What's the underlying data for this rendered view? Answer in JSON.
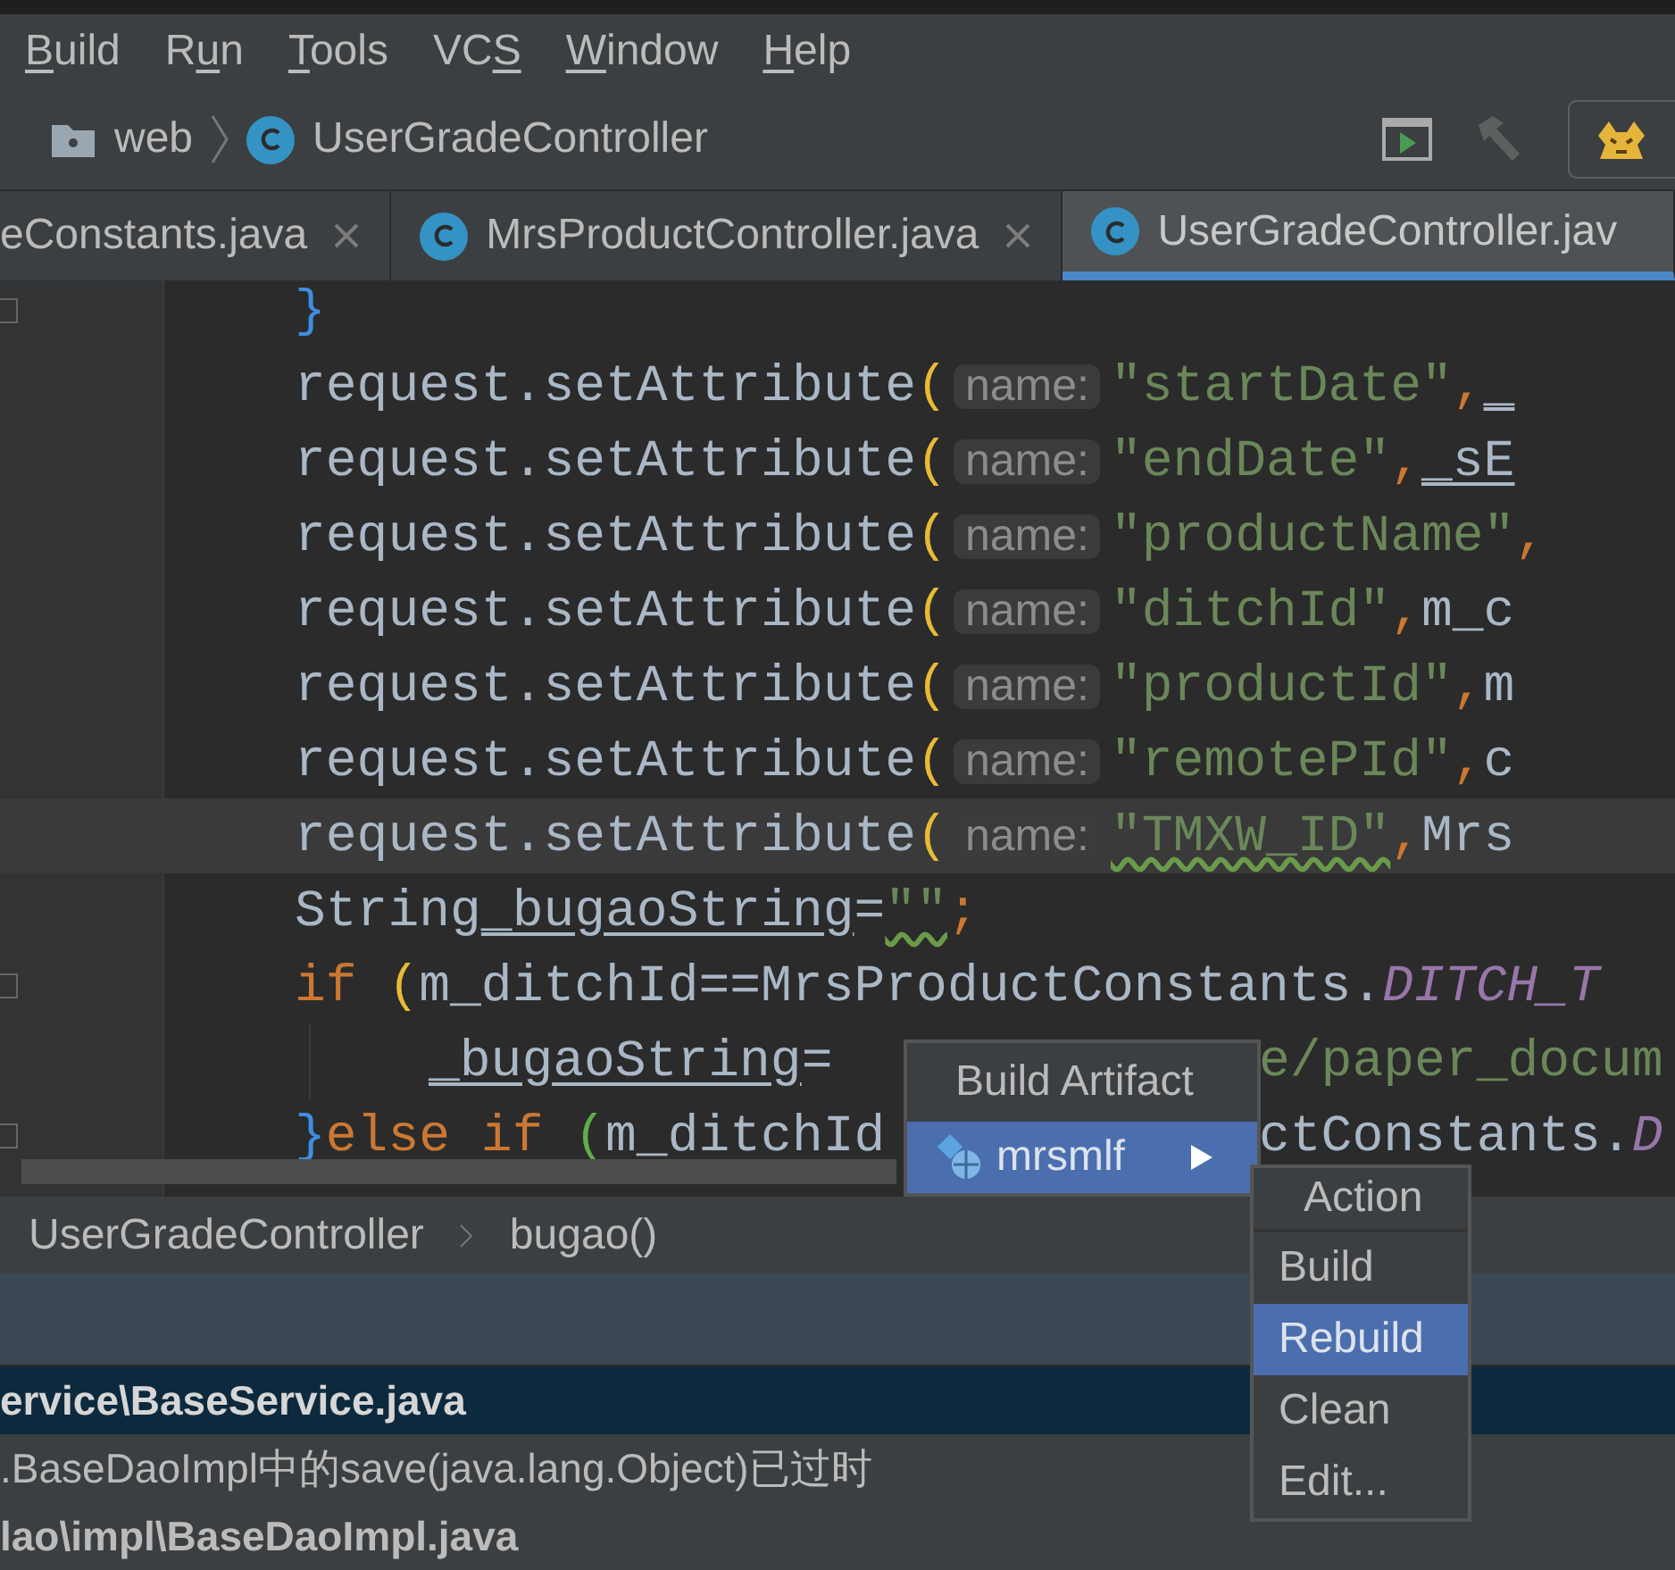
{
  "menu_bar": [
    {
      "key": "B",
      "post": "uild"
    },
    {
      "pre": "R",
      "key": "u",
      "post": "n"
    },
    {
      "key": "T",
      "post": "ools"
    },
    {
      "pre": "VC",
      "key": "S"
    },
    {
      "key": "W",
      "post": "indow"
    },
    {
      "key": "H",
      "post": "elp"
    }
  ],
  "nav_bar": {
    "folder": "web",
    "class_name": "UserGradeController",
    "build_disabled": true
  },
  "tabs": [
    {
      "label": "eConstants.java",
      "icon": false,
      "selected": false,
      "closable": true
    },
    {
      "label": "MrsProductController.java",
      "icon": true,
      "selected": false,
      "closable": true
    },
    {
      "label": "UserGradeController.jav",
      "icon": true,
      "selected": true,
      "closable": false
    }
  ],
  "code_lines": [
    {
      "fold": true,
      "current": false,
      "tokens": [
        {
          "kind": "bracket",
          "text": "}",
          "color": "#3e8ee0"
        }
      ]
    },
    {
      "fold": false,
      "current": false,
      "tokens": [
        {
          "kind": "code",
          "text": "request.setAttribute"
        },
        {
          "kind": "bracket",
          "text": "(",
          "color": "#e8ba36"
        },
        {
          "kind": "hint",
          "text": "name:"
        },
        {
          "kind": "string",
          "text": "\"startDate\""
        },
        {
          "kind": "punct",
          "text": ", "
        },
        {
          "kind": "field",
          "text": "_"
        }
      ]
    },
    {
      "fold": false,
      "current": false,
      "tokens": [
        {
          "kind": "code",
          "text": "request.setAttribute"
        },
        {
          "kind": "bracket",
          "text": "(",
          "color": "#e8ba36"
        },
        {
          "kind": "hint",
          "text": "name:"
        },
        {
          "kind": "string",
          "text": "\"endDate\""
        },
        {
          "kind": "punct",
          "text": ", "
        },
        {
          "kind": "field",
          "text": "_sE"
        }
      ]
    },
    {
      "fold": false,
      "current": false,
      "tokens": [
        {
          "kind": "code",
          "text": "request.setAttribute"
        },
        {
          "kind": "bracket",
          "text": "(",
          "color": "#e8ba36"
        },
        {
          "kind": "hint",
          "text": "name:"
        },
        {
          "kind": "string",
          "text": "\"productName\""
        },
        {
          "kind": "punct",
          "text": ","
        }
      ]
    },
    {
      "fold": false,
      "current": false,
      "tokens": [
        {
          "kind": "code",
          "text": "request.setAttribute"
        },
        {
          "kind": "bracket",
          "text": "(",
          "color": "#e8ba36"
        },
        {
          "kind": "hint",
          "text": "name:"
        },
        {
          "kind": "string",
          "text": "\"ditchId\""
        },
        {
          "kind": "punct",
          "text": ", "
        },
        {
          "kind": "code",
          "text": "m_c"
        }
      ]
    },
    {
      "fold": false,
      "current": false,
      "tokens": [
        {
          "kind": "code",
          "text": "request.setAttribute"
        },
        {
          "kind": "bracket",
          "text": "(",
          "color": "#e8ba36"
        },
        {
          "kind": "hint",
          "text": "name:"
        },
        {
          "kind": "string",
          "text": "\"productId\""
        },
        {
          "kind": "punct",
          "text": ", "
        },
        {
          "kind": "code",
          "text": "m"
        }
      ]
    },
    {
      "fold": false,
      "current": false,
      "tokens": [
        {
          "kind": "code",
          "text": "request.setAttribute"
        },
        {
          "kind": "bracket",
          "text": "(",
          "color": "#e8ba36"
        },
        {
          "kind": "hint",
          "text": "name:"
        },
        {
          "kind": "string",
          "text": "\"remotePId\""
        },
        {
          "kind": "punct",
          "text": ", "
        },
        {
          "kind": "code",
          "text": "c"
        }
      ]
    },
    {
      "fold": false,
      "current": true,
      "tokens": [
        {
          "kind": "code",
          "text": "request.setAttribute"
        },
        {
          "kind": "bracket",
          "text": "(",
          "color": "#e8ba36"
        },
        {
          "kind": "hint",
          "text": "name:"
        },
        {
          "kind": "typo",
          "text": "\"TMXW_ID\""
        },
        {
          "kind": "punct",
          "text": ", "
        },
        {
          "kind": "code",
          "text": "Mrs"
        }
      ]
    },
    {
      "fold": false,
      "current": false,
      "tokens": [
        {
          "kind": "code",
          "text": "String "
        },
        {
          "kind": "field",
          "text": "_bugaoString"
        },
        {
          "kind": "code",
          "text": " = "
        },
        {
          "kind": "typo",
          "text": "\"\""
        },
        {
          "kind": "punct",
          "text": ";"
        }
      ]
    },
    {
      "fold": true,
      "current": false,
      "tokens": [
        {
          "kind": "keyword",
          "text": "if"
        },
        {
          "kind": "bracket",
          "text": "(",
          "color": "#e8ba36"
        },
        {
          "kind": "code",
          "text": "m_ditchId==MrsProductConstants."
        },
        {
          "kind": "constant",
          "text": "DITCH_T"
        }
      ],
      "children": [
        {
          "fold": false,
          "current": false,
          "tokens": [
            {
              "kind": "field",
              "text": "_bugaoString"
            },
            {
              "kind": "code",
              "text": " ="
            }
          ],
          "after": [
            {
              "kind": "string",
              "text": "e/paper_docum"
            }
          ]
        }
      ]
    },
    {
      "fold": true,
      "current": false,
      "tokens": [
        {
          "kind": "bracket",
          "text": "}",
          "color": "#3e8ee0"
        },
        {
          "kind": "keyword",
          "text": "else if"
        },
        {
          "kind": "bracket",
          "text": "(",
          "color": "#5fae4e"
        },
        {
          "kind": "code",
          "text": "m_ditchId"
        }
      ],
      "after": [
        {
          "kind": "code",
          "text": "ctConstants."
        },
        {
          "kind": "constant",
          "text": "D"
        }
      ]
    }
  ],
  "breadcrumb": [
    "UserGradeController",
    "bugao()"
  ],
  "messages": [
    {
      "text": "ervice\\BaseService.java",
      "kind": "file",
      "selected": true
    },
    {
      "text": ".BaseDaoImpl中的save(java.lang.Object)已过时",
      "kind": "warning",
      "selected": false
    },
    {
      "text": "lao\\impl\\BaseDaoImpl.java",
      "kind": "file",
      "selected": false
    }
  ],
  "popup": {
    "title": "Build Artifact",
    "items": [
      {
        "label": "mrsmlf",
        "selected": true
      }
    ],
    "submenu": {
      "title": "Action",
      "items": [
        {
          "label": "Build",
          "selected": false
        },
        {
          "label": "Rebuild",
          "selected": true
        },
        {
          "label": "Clean",
          "selected": false
        },
        {
          "label": "Edit...",
          "selected": false
        }
      ]
    }
  }
}
